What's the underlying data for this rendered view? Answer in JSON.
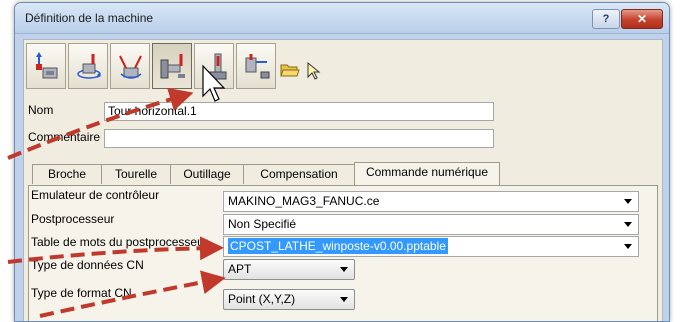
{
  "window": {
    "title": "Définition de la machine",
    "help_label": "?",
    "close_label": "✕"
  },
  "toolbar": {
    "buttons": [
      {
        "icon": "machine-axis-icon"
      },
      {
        "icon": "rotary-table-icon"
      },
      {
        "icon": "tool-axes-icon"
      },
      {
        "icon": "horizontal-lathe-icon",
        "pressed": true
      },
      {
        "icon": "vertical-machine-icon"
      },
      {
        "icon": "turret-machine-icon"
      },
      {
        "icon": "open-folder-icon"
      },
      {
        "icon": "select-arrow-icon"
      }
    ]
  },
  "form": {
    "name_label": "Nom",
    "name_value": "Tour horizontal.1",
    "comment_label": "Commentaire",
    "comment_value": ""
  },
  "tabs": [
    {
      "label": "Broche",
      "active": false
    },
    {
      "label": "Tourelle",
      "active": false
    },
    {
      "label": "Outillage",
      "active": false
    },
    {
      "label": "Compensation",
      "active": false
    },
    {
      "label": "Commande numérique",
      "active": true
    }
  ],
  "nc": {
    "rows": [
      {
        "label": "Emulateur de contrôleur",
        "value": "MAKINO_MAG3_FANUC.ce"
      },
      {
        "label": "Postprocesseur",
        "value": "Non Specifié"
      },
      {
        "label": "Table de mots du postprocesseur",
        "value": "CPOST_LATHE_winposte-v0.00.pptable"
      },
      {
        "label": "Type de données CN",
        "value": "APT"
      },
      {
        "label": "Type de format CN",
        "value": "Point (X,Y,Z)"
      }
    ]
  },
  "colors": {
    "annotation_arrow": "#c0392b",
    "selection": "#3399ff",
    "close_button": "#c4402a"
  }
}
